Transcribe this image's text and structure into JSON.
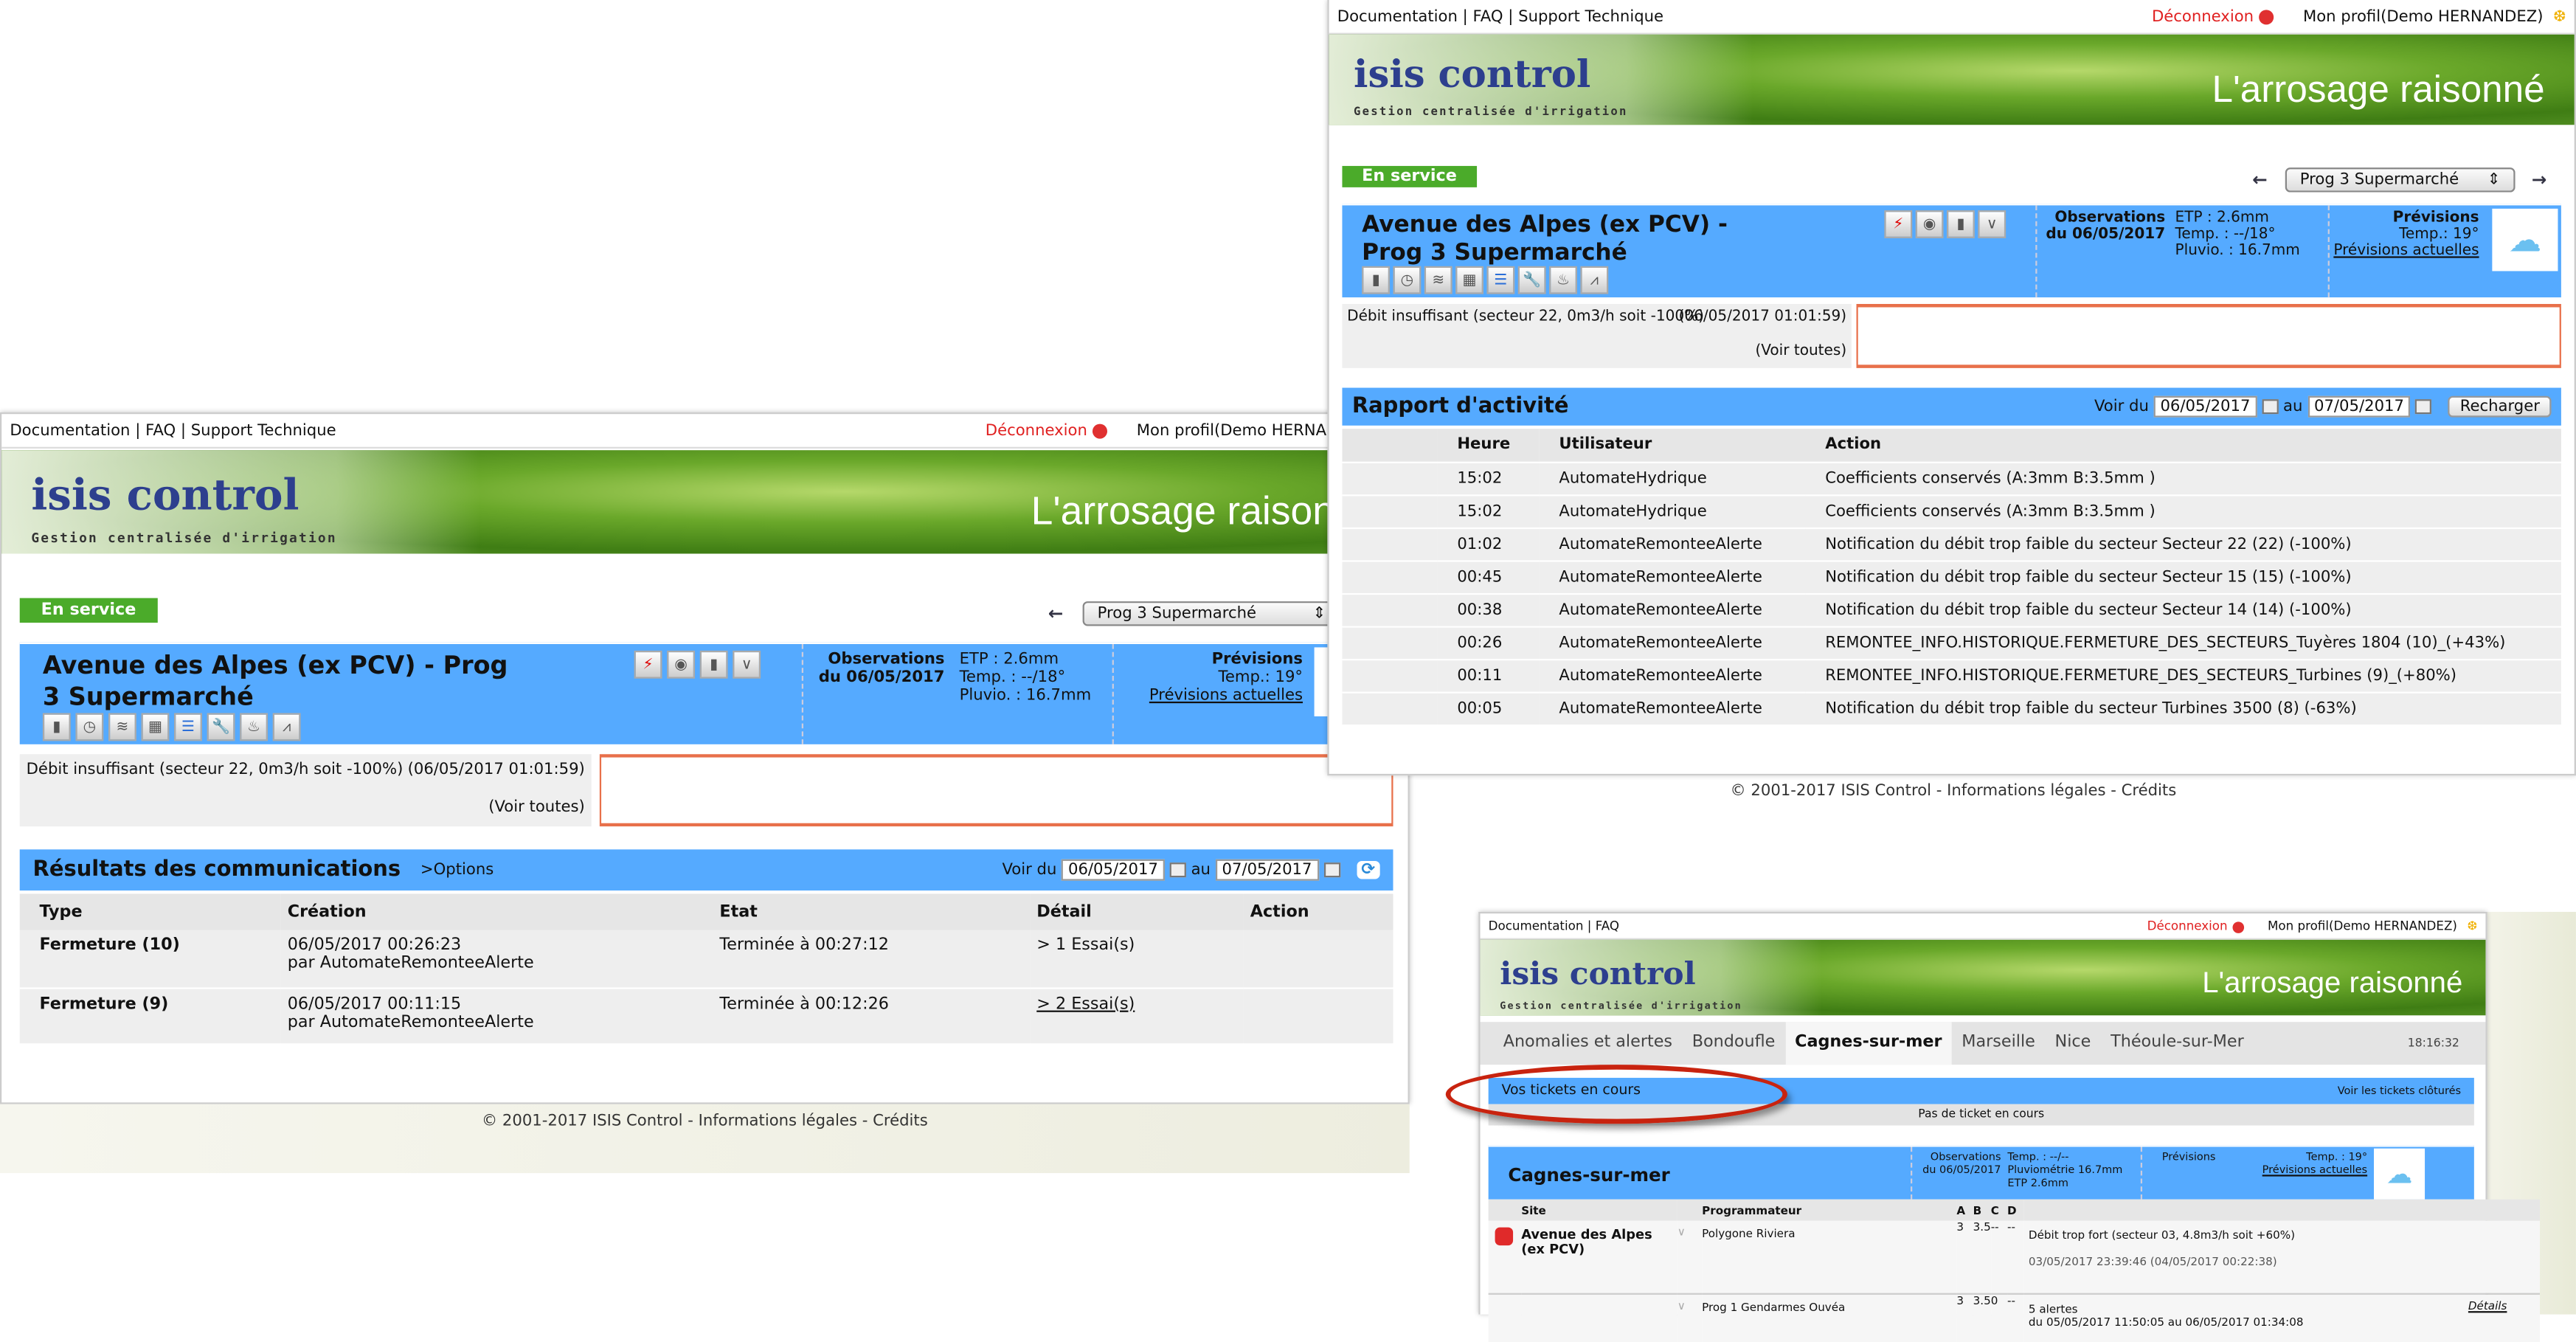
{
  "colors": {
    "blue_header": "#55aaff",
    "service_green": "#4bab2a",
    "logout_red": "#e02020",
    "alert_border": "#e8704a",
    "highlight_ellipse": "#c8230f"
  },
  "common": {
    "doc": "Documentation",
    "faq": "FAQ",
    "support": "Support Technique",
    "sep": "|",
    "logout": "Déconnexion",
    "profile": "Mon profil(Demo HERNANDEZ)",
    "logo": "isis control",
    "logo_sub": "Gestion centralisée d'irrigation",
    "tagline": "L'arrosage raisonné",
    "footer": "© 2001-2017 ISIS Control - Informations légales - Crédits",
    "service": "En service",
    "prog_select": "Prog 3 Supermarché",
    "prev_arrow": "←",
    "next_arrow": "→",
    "site_title": "Avenue des Alpes (ex PCV) - Prog 3 Supermarché",
    "obs_label": "Observations",
    "obs_date": "du 06/05/2017",
    "etp": "ETP : 2.6mm",
    "temp": "Temp. : --/18°",
    "pluvio": "Pluvio. : 16.7mm",
    "prev_label": "Prévisions",
    "prev_temp": "Temp.: 19°",
    "prev_link": "Prévisions actuelles",
    "alert_text": "Débit insuffisant (secteur 22, 0m3/h soit -100%)",
    "alert_time": "(06/05/2017 01:01:59)",
    "alert_all": "(Voir toutes)",
    "voir_du": "Voir du",
    "date_from": "06/05/2017",
    "au": "au",
    "date_to": "07/05/2017"
  },
  "left": {
    "section": "Résultats des communications",
    "options": ">Options",
    "headers": [
      "Type",
      "Création",
      "Etat",
      "Détail",
      "Action"
    ],
    "rows": [
      {
        "type": "Fermeture (10)",
        "created": "06/05/2017 00:26:23",
        "by": "par AutomateRemonteeAlerte",
        "etat": "Terminée à 00:27:12",
        "detail": "> 1 Essai(s)",
        "action": ""
      },
      {
        "type": "Fermeture (9)",
        "created": "06/05/2017 00:11:15",
        "by": "par AutomateRemonteeAlerte",
        "etat": "Terminée à 00:12:26",
        "detail": "> 2 Essai(s)",
        "action": ""
      }
    ]
  },
  "topright": {
    "section": "Rapport d'activité",
    "reload": "Recharger",
    "headers": [
      "",
      "Heure",
      "Utilisateur",
      "Action"
    ],
    "rows": [
      [
        "15:02",
        "AutomateHydrique",
        "Coefficients conservés (A:3mm B:3.5mm )"
      ],
      [
        "15:02",
        "AutomateHydrique",
        "Coefficients conservés (A:3mm B:3.5mm )"
      ],
      [
        "01:02",
        "AutomateRemonteeAlerte",
        "Notification du débit trop faible du secteur Secteur 22 (22) (-100%)"
      ],
      [
        "00:45",
        "AutomateRemonteeAlerte",
        "Notification du débit trop faible du secteur Secteur 15 (15) (-100%)"
      ],
      [
        "00:38",
        "AutomateRemonteeAlerte",
        "Notification du débit trop faible du secteur Secteur 14 (14) (-100%)"
      ],
      [
        "00:26",
        "AutomateRemonteeAlerte",
        "REMONTEE_INFO.HISTORIQUE.FERMETURE_DES_SECTEURS_Tuyères 1804 (10)_(+43%)"
      ],
      [
        "00:11",
        "AutomateRemonteeAlerte",
        "REMONTEE_INFO.HISTORIQUE.FERMETURE_DES_SECTEURS_Turbines (9)_(+80%)"
      ],
      [
        "00:05",
        "AutomateRemonteeAlerte",
        "Notification du débit trop faible du secteur Turbines 3500 (8) (-63%)"
      ]
    ]
  },
  "bottomright": {
    "tabs": [
      "Anomalies et alertes",
      "Bondoufle",
      "Cagnes-sur-mer",
      "Marseille",
      "Nice",
      "Théoule-sur-Mer"
    ],
    "active_tab": "Cagnes-sur-mer",
    "clock": "18:16:32",
    "tickets_title": "Vos tickets en cours",
    "tickets_closed": "Voir les tickets clôturés",
    "no_ticket": "Pas de ticket en cours",
    "city": "Cagnes-sur-mer",
    "obs_label": "Observations",
    "obs_date": "du 06/05/2017",
    "temp": "Temp. : --/--",
    "pluvio": "Pluviométrie 16.7mm",
    "etp": "ETP 2.6mm",
    "prev_label": "Prévisions",
    "prev_temp": "Temp. : 19°",
    "prev_link": "Prévisions actuelles",
    "headers": [
      "Site",
      "Programmateur",
      "A",
      "B",
      "C",
      "D"
    ],
    "site": "Avenue des Alpes (ex PCV)",
    "rows": [
      {
        "prog": "Polygone Riviera",
        "a": "3",
        "b": "3.5",
        "c": "--",
        "d": "--",
        "msg": "Débit trop fort (secteur 03, 4.8m3/h soit +60%)",
        "msg2": "03/05/2017 23:39:46 (04/05/2017 00:22:38)",
        "link": ""
      },
      {
        "prog": "Prog 1 Gendarmes Ouvéa",
        "a": "3",
        "b": "3.5",
        "c": "0",
        "d": "--",
        "msg": "5 alertes",
        "msg2": "du 05/05/2017 11:50:05 au 06/05/2017 01:34:08",
        "link": "Détails"
      }
    ]
  }
}
